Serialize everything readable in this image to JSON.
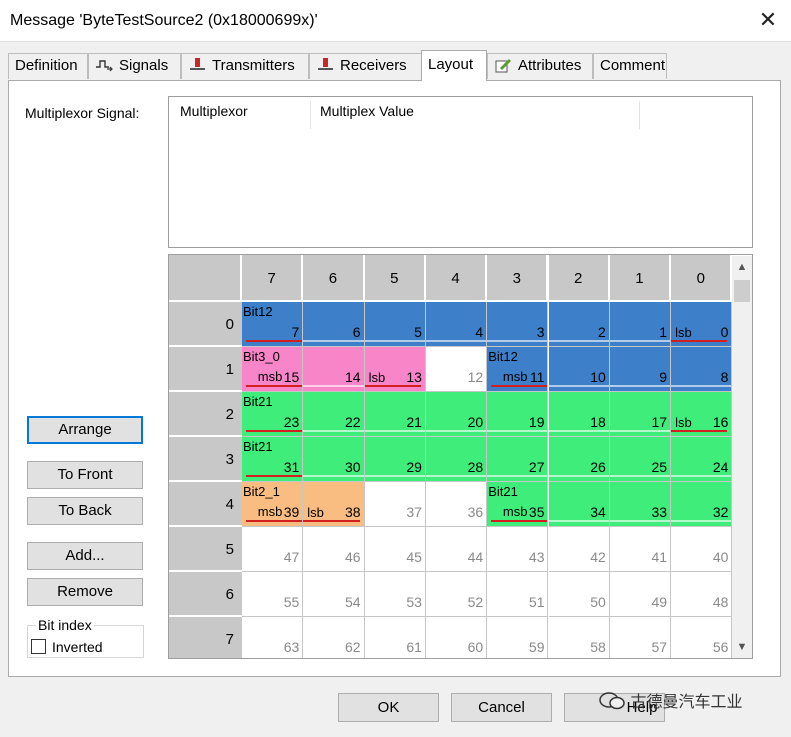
{
  "window": {
    "title": "Message 'ByteTestSource2 (0x18000699x)'",
    "close": "✕"
  },
  "tabs": [
    {
      "label": "Definition",
      "icon": "",
      "active": false
    },
    {
      "label": "Signals",
      "icon": "signals-icon",
      "active": false
    },
    {
      "label": "Transmitters",
      "icon": "ecu-transmitter-icon",
      "active": false
    },
    {
      "label": "Receivers",
      "icon": "ecu-receiver-icon",
      "active": false
    },
    {
      "label": "Layout",
      "icon": "",
      "active": true
    },
    {
      "label": "Attributes",
      "icon": "attributes-edit-icon",
      "active": false
    },
    {
      "label": "Comment",
      "icon": "",
      "active": false
    }
  ],
  "multiplexor": {
    "label": "Multiplexor Signal:",
    "columns": [
      "Multiplexor",
      "Multiplex Value"
    ]
  },
  "buttons": {
    "arrange": "Arrange",
    "to_front": "To Front",
    "to_back": "To Back",
    "add": "Add...",
    "remove": "Remove"
  },
  "bit_index": {
    "legend": "Bit index",
    "inverted_label": "Inverted",
    "inverted_checked": false
  },
  "layout_grid": {
    "col_headers": [
      "7",
      "6",
      "5",
      "4",
      "3",
      "2",
      "1",
      "0"
    ],
    "row_headers": [
      "0",
      "1",
      "2",
      "3",
      "4",
      "5",
      "6",
      "7"
    ],
    "colors": {
      "blue": "#3d7fc9",
      "pink": "#f985c9",
      "green": "#3fee7a",
      "orange": "#f9bd82",
      "arrow": "#d21f1f"
    },
    "rows": [
      [
        {
          "num": "7",
          "color": "blue",
          "sig": "Bit12"
        },
        {
          "num": "6",
          "color": "blue"
        },
        {
          "num": "5",
          "color": "blue"
        },
        {
          "num": "4",
          "color": "blue"
        },
        {
          "num": "3",
          "color": "blue"
        },
        {
          "num": "2",
          "color": "blue"
        },
        {
          "num": "1",
          "color": "blue"
        },
        {
          "num": "0",
          "color": "blue",
          "lsb": "lsb"
        }
      ],
      [
        {
          "num": "15",
          "color": "pink",
          "sig": "Bit3_0",
          "msb": "msb"
        },
        {
          "num": "14",
          "color": "pink"
        },
        {
          "num": "13",
          "color": "pink",
          "lsb": "lsb"
        },
        {
          "num": "12",
          "color": ""
        },
        {
          "num": "11",
          "color": "blue",
          "sig": "Bit12",
          "msb": "msb"
        },
        {
          "num": "10",
          "color": "blue"
        },
        {
          "num": "9",
          "color": "blue"
        },
        {
          "num": "8",
          "color": "blue"
        }
      ],
      [
        {
          "num": "23",
          "color": "green",
          "sig": "Bit21"
        },
        {
          "num": "22",
          "color": "green"
        },
        {
          "num": "21",
          "color": "green"
        },
        {
          "num": "20",
          "color": "green"
        },
        {
          "num": "19",
          "color": "green"
        },
        {
          "num": "18",
          "color": "green"
        },
        {
          "num": "17",
          "color": "green"
        },
        {
          "num": "16",
          "color": "green",
          "lsb": "lsb"
        }
      ],
      [
        {
          "num": "31",
          "color": "green",
          "sig": "Bit21"
        },
        {
          "num": "30",
          "color": "green"
        },
        {
          "num": "29",
          "color": "green"
        },
        {
          "num": "28",
          "color": "green"
        },
        {
          "num": "27",
          "color": "green"
        },
        {
          "num": "26",
          "color": "green"
        },
        {
          "num": "25",
          "color": "green"
        },
        {
          "num": "24",
          "color": "green"
        }
      ],
      [
        {
          "num": "39",
          "color": "orange",
          "sig": "Bit2_1",
          "msb": "msb"
        },
        {
          "num": "38",
          "color": "orange",
          "lsb": "lsb"
        },
        {
          "num": "37",
          "color": ""
        },
        {
          "num": "36",
          "color": ""
        },
        {
          "num": "35",
          "color": "green",
          "sig": "Bit21",
          "msb": "msb"
        },
        {
          "num": "34",
          "color": "green"
        },
        {
          "num": "33",
          "color": "green"
        },
        {
          "num": "32",
          "color": "green"
        }
      ],
      [
        {
          "num": "47",
          "color": ""
        },
        {
          "num": "46",
          "color": ""
        },
        {
          "num": "45",
          "color": ""
        },
        {
          "num": "44",
          "color": ""
        },
        {
          "num": "43",
          "color": ""
        },
        {
          "num": "42",
          "color": ""
        },
        {
          "num": "41",
          "color": ""
        },
        {
          "num": "40",
          "color": ""
        }
      ],
      [
        {
          "num": "55",
          "color": ""
        },
        {
          "num": "54",
          "color": ""
        },
        {
          "num": "53",
          "color": ""
        },
        {
          "num": "52",
          "color": ""
        },
        {
          "num": "51",
          "color": ""
        },
        {
          "num": "50",
          "color": ""
        },
        {
          "num": "49",
          "color": ""
        },
        {
          "num": "48",
          "color": ""
        }
      ],
      [
        {
          "num": "63",
          "color": ""
        },
        {
          "num": "62",
          "color": ""
        },
        {
          "num": "61",
          "color": ""
        },
        {
          "num": "60",
          "color": ""
        },
        {
          "num": "59",
          "color": ""
        },
        {
          "num": "58",
          "color": ""
        },
        {
          "num": "57",
          "color": ""
        },
        {
          "num": "56",
          "color": ""
        }
      ]
    ],
    "scroll_up": "▲",
    "scroll_down": "▼"
  },
  "footer": {
    "ok": "OK",
    "cancel": "Cancel",
    "help": "Help",
    "watermark": "古德曼汽车工业"
  }
}
